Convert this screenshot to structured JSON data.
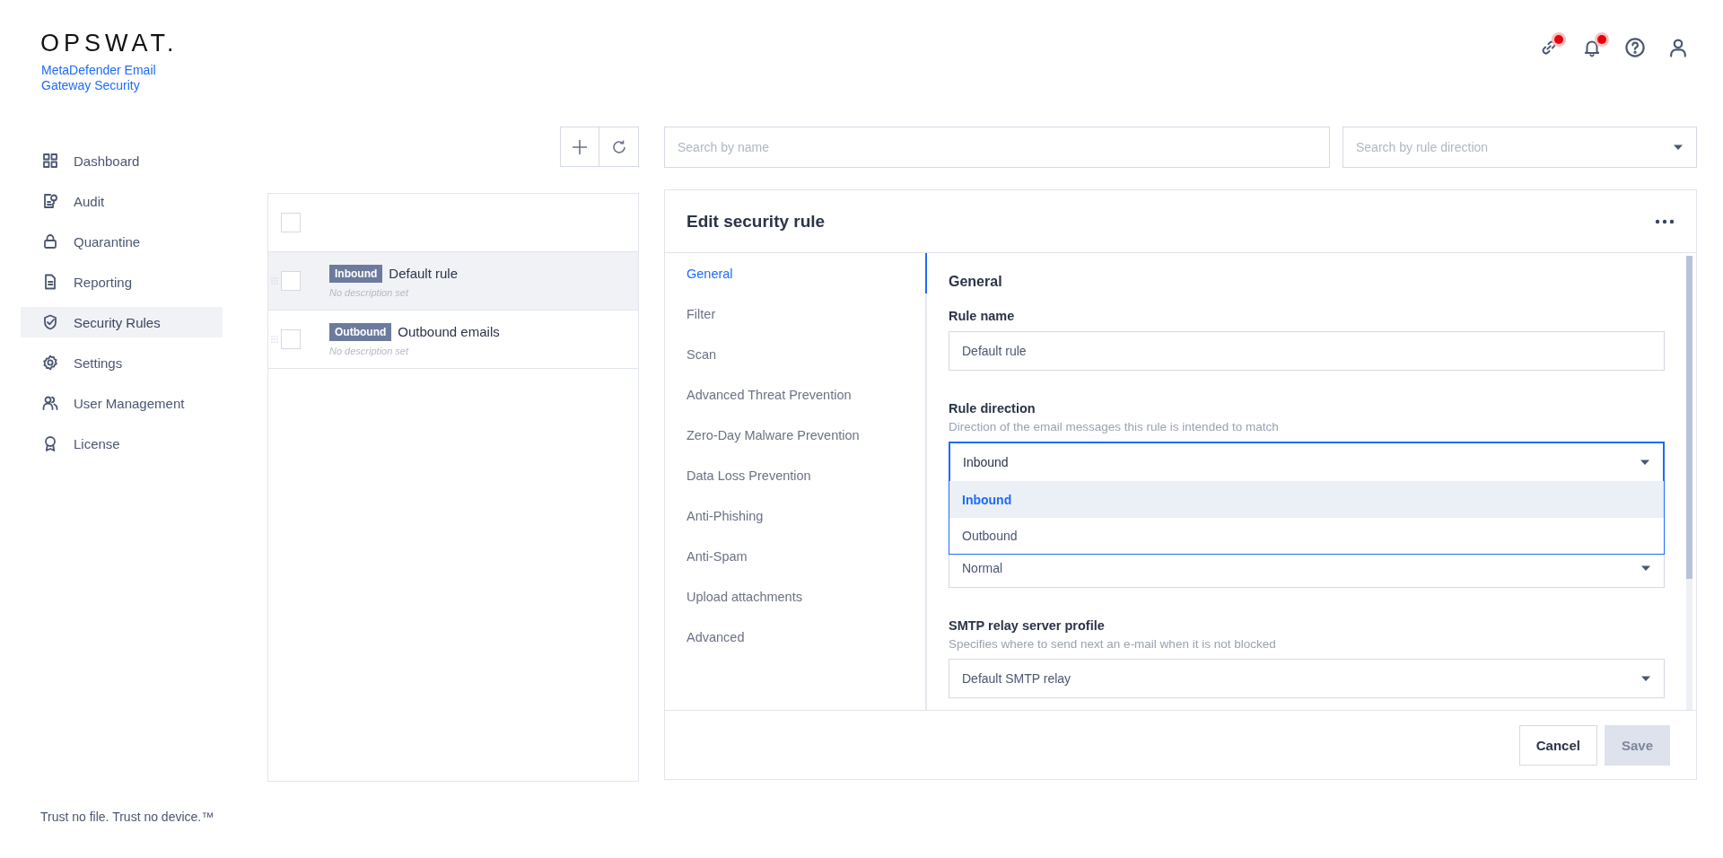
{
  "brand": {
    "logo": "OPSWAT.",
    "product": "MetaDefender Email Gateway Security"
  },
  "header_icons": [
    {
      "kind": "link",
      "badge": true
    },
    {
      "kind": "bell",
      "badge": true
    },
    {
      "kind": "help",
      "badge": false
    },
    {
      "kind": "user",
      "badge": false
    }
  ],
  "sidebar": {
    "items": [
      {
        "label": "Dashboard",
        "kind": "grid",
        "selected": false
      },
      {
        "label": "Audit",
        "kind": "audit",
        "selected": false
      },
      {
        "label": "Quarantine",
        "kind": "lock",
        "selected": false
      },
      {
        "label": "Reporting",
        "kind": "doc",
        "selected": false
      },
      {
        "label": "Security Rules",
        "kind": "shield",
        "selected": true
      },
      {
        "label": "Settings",
        "kind": "gear",
        "selected": false
      },
      {
        "label": "User Management",
        "kind": "users",
        "selected": false
      },
      {
        "label": "License",
        "kind": "award",
        "selected": false
      }
    ]
  },
  "rules_list": {
    "select_all_checked": false,
    "rows": [
      {
        "direction": "Inbound",
        "name": "Default rule",
        "description": "No description set",
        "selected": true,
        "checked": false
      },
      {
        "direction": "Outbound",
        "name": "Outbound emails",
        "description": "No description set",
        "selected": false,
        "checked": false
      }
    ]
  },
  "search": {
    "name_placeholder": "Search by name",
    "direction_placeholder": "Search by rule direction"
  },
  "editor": {
    "title": "Edit security rule",
    "tabs": [
      {
        "label": "General",
        "selected": true
      },
      {
        "label": "Filter",
        "selected": false
      },
      {
        "label": "Scan",
        "selected": false
      },
      {
        "label": "Advanced Threat Prevention",
        "selected": false
      },
      {
        "label": "Zero-Day Malware Prevention",
        "selected": false
      },
      {
        "label": "Data Loss Prevention",
        "selected": false
      },
      {
        "label": "Anti-Phishing",
        "selected": false
      },
      {
        "label": "Anti-Spam",
        "selected": false
      },
      {
        "label": "Upload attachments",
        "selected": false
      },
      {
        "label": "Advanced",
        "selected": false
      }
    ],
    "section_title": "General",
    "fields": [
      {
        "kind": "text",
        "label": "Rule name",
        "value": "Default rule"
      },
      {
        "kind": "select",
        "label": "Rule direction",
        "description": "Direction of the email messages this rule is intended to match",
        "value": "Inbound",
        "open": true,
        "options": [
          {
            "label": "Inbound",
            "selected": true
          },
          {
            "label": "Outbound",
            "selected": false
          }
        ]
      },
      {
        "kind": "select",
        "value": "Normal",
        "open": false
      },
      {
        "kind": "select",
        "label": "SMTP relay server profile",
        "description": "Specifies where to send next an e-mail when it is not blocked",
        "value": "Default SMTP relay",
        "open": false
      }
    ],
    "buttons": [
      {
        "label": "Cancel",
        "disabled": false
      },
      {
        "label": "Save",
        "disabled": true
      }
    ]
  },
  "tagline": "Trust no file. Trust no device.™"
}
